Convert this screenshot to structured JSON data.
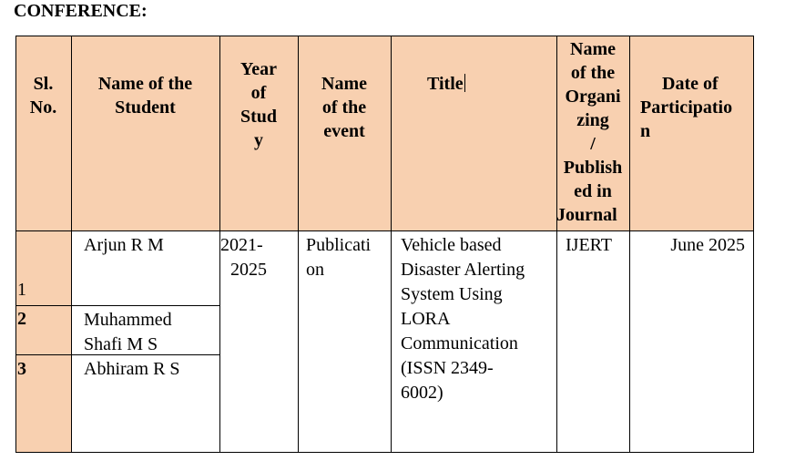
{
  "heading": "CONFERENCE:",
  "headers": {
    "sl_no": [
      "Sl.",
      "No."
    ],
    "student": [
      "Name of the",
      "Student"
    ],
    "year": [
      "Year",
      "of",
      "Stud",
      "y"
    ],
    "event": [
      "Name",
      "of the",
      "event"
    ],
    "title": "Title",
    "organizer": [
      "Name",
      "of the",
      "Organi",
      "zing",
      "/",
      "Publish",
      "ed in",
      "Journal"
    ],
    "date": [
      "Date of",
      "Participatio",
      "n"
    ]
  },
  "rows": [
    {
      "sl": "1",
      "name": [
        "Arjun R M"
      ]
    },
    {
      "sl": "2",
      "name": [
        "Muhammed",
        "Shafi M S"
      ]
    },
    {
      "sl": "3",
      "name": [
        "Abhiram R S"
      ]
    }
  ],
  "year": [
    "2021-",
    "2025"
  ],
  "event": [
    "Publicati",
    "on"
  ],
  "title": [
    "Vehicle based",
    "Disaster Alerting",
    "System Using",
    "LORA",
    "Communication",
    "(ISSN 2349-",
    "6002)"
  ],
  "organizer": "IJERT",
  "date": "June 2025"
}
